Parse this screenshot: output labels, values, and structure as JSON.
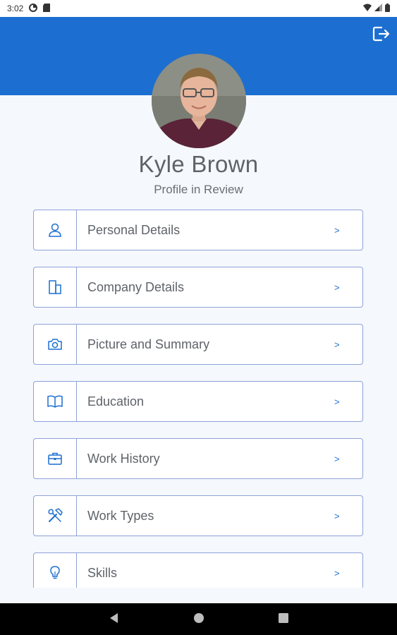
{
  "status_bar": {
    "time": "3:02"
  },
  "profile": {
    "name": "Kyle Brown",
    "status": "Profile in Review"
  },
  "menu": {
    "items": [
      {
        "label": "Personal Details",
        "icon": "person-icon",
        "chevron": ">"
      },
      {
        "label": "Company Details",
        "icon": "building-icon",
        "chevron": ">"
      },
      {
        "label": "Picture and Summary",
        "icon": "camera-icon",
        "chevron": ">"
      },
      {
        "label": "Education",
        "icon": "book-icon",
        "chevron": ">"
      },
      {
        "label": "Work History",
        "icon": "briefcase-icon",
        "chevron": ">"
      },
      {
        "label": "Work Types",
        "icon": "tools-icon",
        "chevron": ">"
      },
      {
        "label": "Skills",
        "icon": "lightbulb-icon",
        "chevron": ">"
      }
    ]
  },
  "colors": {
    "header": "#1c6fd0",
    "accent": "#1c6fd0",
    "border": "#8ea2d8"
  }
}
